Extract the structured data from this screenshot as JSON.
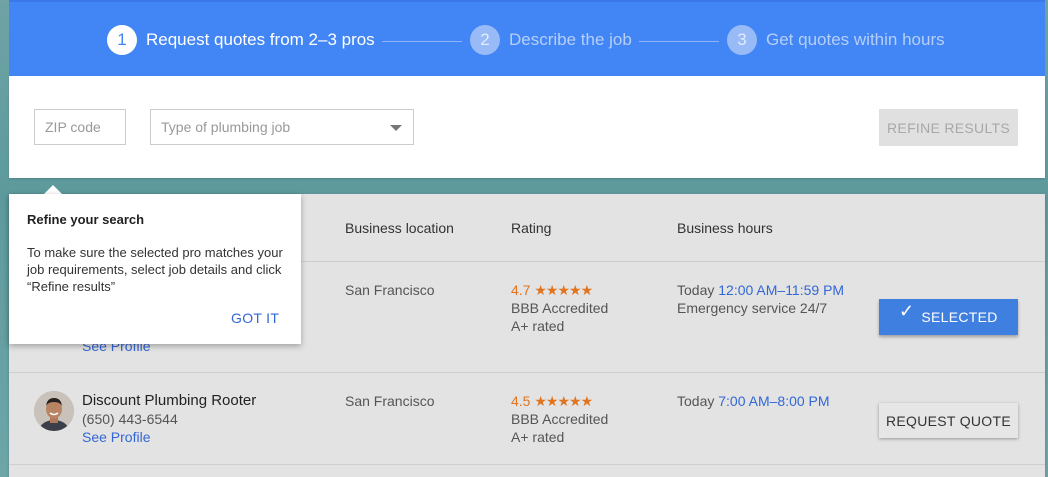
{
  "steps": [
    {
      "num": "1",
      "label": "Request quotes from 2–3 pros"
    },
    {
      "num": "2",
      "label": "Describe the job"
    },
    {
      "num": "3",
      "label": "Get quotes within hours"
    }
  ],
  "search": {
    "zip_placeholder": "ZIP code",
    "job_type_placeholder": "Type of plumbing job",
    "refine_label": "REFINE RESULTS"
  },
  "columns": {
    "location": "Business location",
    "rating": "Rating",
    "hours": "Business hours"
  },
  "results": [
    {
      "location": "San Francisco",
      "rating": "4.7",
      "stars": "★★★★★",
      "accreditation": "BBB Accredited",
      "grade": "A+ rated",
      "hours_day": "Today",
      "hours_time": "12:00 AM–11:59 PM",
      "hours_note": "Emergency service 24/7",
      "profile_link": "See Profile",
      "action": "SELECTED"
    },
    {
      "name": "Discount Plumbing Rooter",
      "phone": "(650) 443-6544",
      "profile_link": "See Profile",
      "location": "San Francisco",
      "rating": "4.5",
      "stars": "★★★★★",
      "accreditation": "BBB Accredited",
      "grade": "A+ rated",
      "hours_day": "Today",
      "hours_time": "7:00 AM–8:00 PM",
      "action": "REQUEST QUOTE"
    }
  ],
  "tooltip": {
    "title": "Refine your search",
    "body": "To make sure the selected pro matches your job requirements, select job details and click “Refine results”",
    "button": "GOT IT"
  },
  "colors": {
    "primary": "#4285f4",
    "link": "#3367d6",
    "rating": "#e0741f"
  }
}
